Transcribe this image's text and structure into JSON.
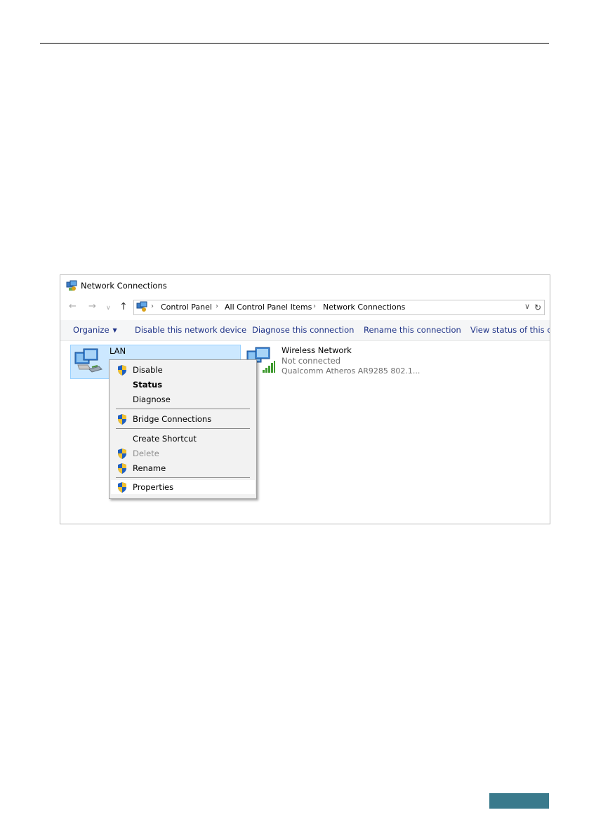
{
  "window": {
    "title": "Network Connections"
  },
  "address_bar": {
    "breadcrumbs": [
      "Control Panel",
      "All Control Panel Items",
      "Network Connections"
    ]
  },
  "command_bar": {
    "organize": "Organize",
    "disable_device": "Disable this network device",
    "diagnose": "Diagnose this connection",
    "rename": "Rename this connection",
    "view_status": "View status of this co"
  },
  "connections": [
    {
      "name": "LAN",
      "status": "",
      "device": ""
    },
    {
      "name": "Wireless Network",
      "status": "Not connected",
      "device": "Qualcomm Atheros AR9285 802.1..."
    }
  ],
  "context_menu": {
    "items": [
      {
        "label": "Disable",
        "shield": true,
        "bold": false,
        "disabled": false
      },
      {
        "label": "Status",
        "shield": false,
        "bold": true,
        "disabled": false
      },
      {
        "label": "Diagnose",
        "shield": false,
        "bold": false,
        "disabled": false
      },
      {
        "label": "Bridge Connections",
        "shield": true,
        "bold": false,
        "disabled": false
      },
      {
        "label": "Create Shortcut",
        "shield": false,
        "bold": false,
        "disabled": false
      },
      {
        "label": "Delete",
        "shield": true,
        "bold": false,
        "disabled": true
      },
      {
        "label": "Rename",
        "shield": true,
        "bold": false,
        "disabled": false
      },
      {
        "label": "Properties",
        "shield": true,
        "bold": false,
        "disabled": false
      }
    ]
  },
  "colors": {
    "accent_footer": "#3a7a8c",
    "selection": "#cce8ff",
    "command_text": "#1e3287"
  }
}
